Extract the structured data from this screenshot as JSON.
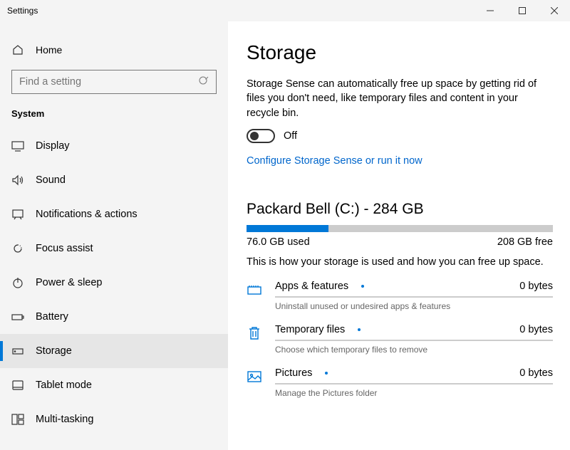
{
  "window": {
    "title": "Settings"
  },
  "sidebar": {
    "home": "Home",
    "search_placeholder": "Find a setting",
    "group": "System",
    "items": [
      {
        "label": "Display"
      },
      {
        "label": "Sound"
      },
      {
        "label": "Notifications & actions"
      },
      {
        "label": "Focus assist"
      },
      {
        "label": "Power & sleep"
      },
      {
        "label": "Battery"
      },
      {
        "label": "Storage",
        "selected": true
      },
      {
        "label": "Tablet mode"
      },
      {
        "label": "Multi-tasking"
      }
    ]
  },
  "page": {
    "title": "Storage",
    "sense_desc": "Storage Sense can automatically free up space by getting rid of files you don't need, like temporary files and content in your recycle bin.",
    "toggle_label": "Off",
    "toggle_state": false,
    "config_link": "Configure Storage Sense or run it now",
    "drive": {
      "title": "Packard Bell (C:) - 284 GB",
      "used_percent": 26.7,
      "used_label": "76.0 GB used",
      "free_label": "208 GB free"
    },
    "usage_desc": "This is how your storage is used and how you can free up space.",
    "categories": [
      {
        "name": "Apps & features",
        "size": "0 bytes",
        "sub": "Uninstall unused or undesired apps & features"
      },
      {
        "name": "Temporary files",
        "size": "0 bytes",
        "sub": "Choose which temporary files to remove"
      },
      {
        "name": "Pictures",
        "size": "0 bytes",
        "sub": "Manage the Pictures folder"
      }
    ]
  }
}
